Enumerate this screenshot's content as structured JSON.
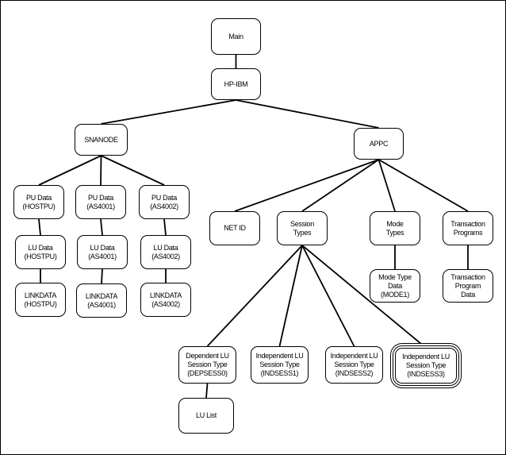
{
  "nodes": {
    "main": [
      "Main"
    ],
    "hp_ibm": [
      "HP-IBM"
    ],
    "snanode": [
      "SNANODE"
    ],
    "appc": [
      "APPC"
    ],
    "pu_hostpu": [
      "PU Data",
      "(HOSTPU)"
    ],
    "pu_as4001": [
      "PU Data",
      "(AS4001)"
    ],
    "pu_as4002": [
      "PU Data",
      "(AS4002)"
    ],
    "lu_hostpu": [
      "LU Data",
      "(HOSTPU)"
    ],
    "lu_as4001": [
      "LU Data",
      "(AS4001)"
    ],
    "lu_as4002": [
      "LU Data",
      "(AS4002)"
    ],
    "link_hostpu": [
      "LINKDATA",
      "(HOSTPU)"
    ],
    "link_as4001": [
      "LINKDATA",
      "(AS4001)"
    ],
    "link_as4002": [
      "LINKDATA",
      "(AS4002)"
    ],
    "net_id": [
      "NET ID"
    ],
    "session_types": [
      "Session",
      "Types"
    ],
    "mode_types": [
      "Mode",
      "Types"
    ],
    "transaction_programs": [
      "Transaction",
      "Programs"
    ],
    "mode_type_data": [
      "Mode Type",
      "Data",
      "(MODE1)"
    ],
    "transaction_program_data": [
      "Transaction",
      "Program",
      "Data"
    ],
    "depsess0": [
      "Dependent LU",
      "Session Type",
      "(DEPSESS0)"
    ],
    "indsess1": [
      "Independent LU",
      "Session Type",
      "(INDSESS1)"
    ],
    "indsess2": [
      "Independent LU",
      "Session Type",
      "(INDSESS2)"
    ],
    "indsess3": [
      "Independent LU",
      "Session Type",
      "(INDSESS3)"
    ],
    "lu_list": [
      "LU List"
    ]
  },
  "edges": [
    [
      "main",
      "hp_ibm"
    ],
    [
      "hp_ibm",
      "snanode"
    ],
    [
      "hp_ibm",
      "appc"
    ],
    [
      "snanode",
      "pu_hostpu"
    ],
    [
      "snanode",
      "pu_as4001"
    ],
    [
      "snanode",
      "pu_as4002"
    ],
    [
      "pu_hostpu",
      "lu_hostpu"
    ],
    [
      "pu_as4001",
      "lu_as4001"
    ],
    [
      "pu_as4002",
      "lu_as4002"
    ],
    [
      "lu_hostpu",
      "link_hostpu"
    ],
    [
      "lu_as4001",
      "link_as4001"
    ],
    [
      "lu_as4002",
      "link_as4002"
    ],
    [
      "appc",
      "net_id"
    ],
    [
      "appc",
      "session_types"
    ],
    [
      "appc",
      "mode_types"
    ],
    [
      "appc",
      "transaction_programs"
    ],
    [
      "mode_types",
      "mode_type_data"
    ],
    [
      "transaction_programs",
      "transaction_program_data"
    ],
    [
      "session_types",
      "depsess0"
    ],
    [
      "session_types",
      "indsess1"
    ],
    [
      "session_types",
      "indsess2"
    ],
    [
      "session_types",
      "indsess3"
    ],
    [
      "depsess0",
      "lu_list"
    ]
  ],
  "highlighted_node": "indsess3"
}
